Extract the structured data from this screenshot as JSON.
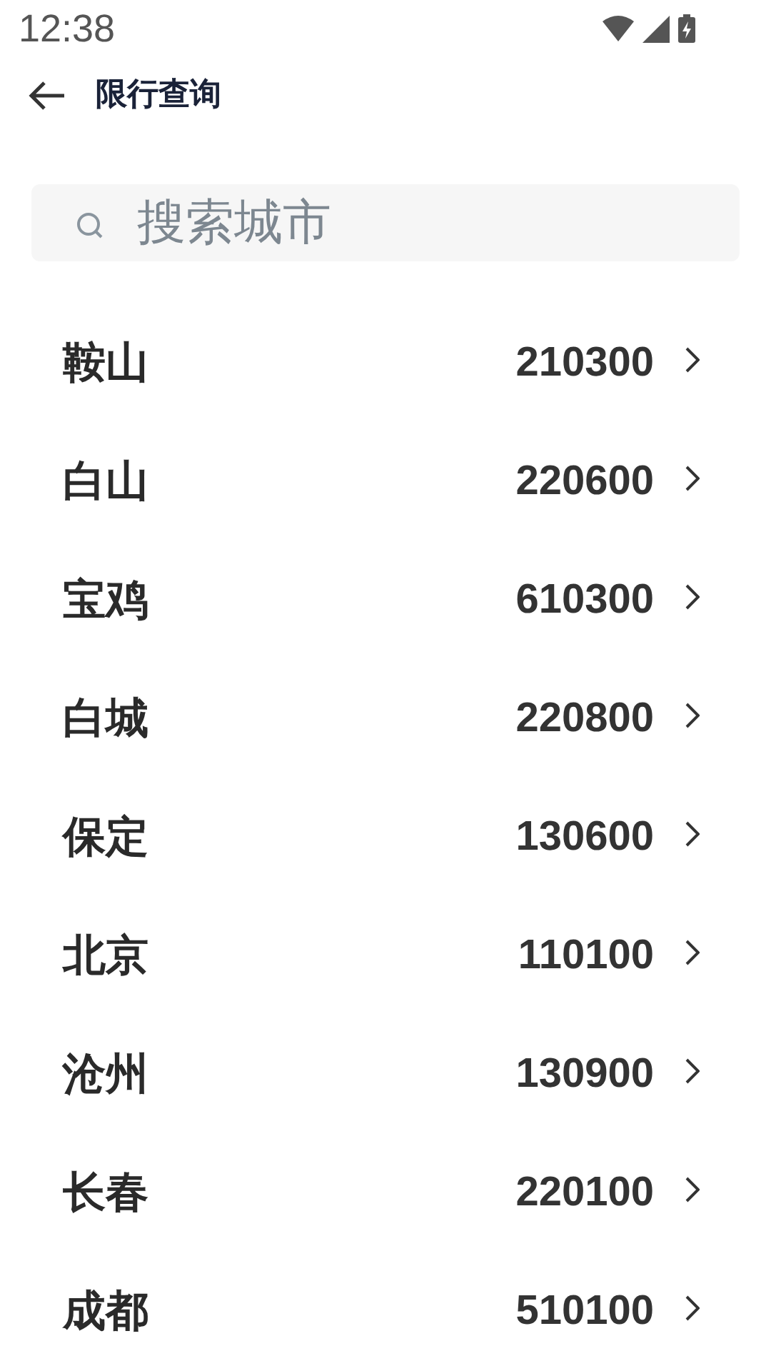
{
  "status_bar": {
    "time": "12:38"
  },
  "header": {
    "title": "限行查询"
  },
  "search": {
    "placeholder": "搜索城市"
  },
  "cities": [
    {
      "name": "鞍山",
      "code": "210300"
    },
    {
      "name": "白山",
      "code": "220600"
    },
    {
      "name": "宝鸡",
      "code": "610300"
    },
    {
      "name": "白城",
      "code": "220800"
    },
    {
      "name": "保定",
      "code": "130600"
    },
    {
      "name": "北京",
      "code": "110100"
    },
    {
      "name": "沧州",
      "code": "130900"
    },
    {
      "name": "长春",
      "code": "220100"
    },
    {
      "name": "成都",
      "code": "510100"
    }
  ]
}
